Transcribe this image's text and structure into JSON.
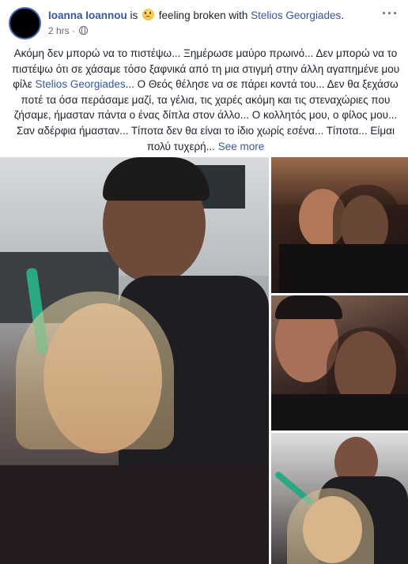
{
  "post": {
    "author": "Ioanna Ioannou",
    "is_text": "is",
    "feeling_icon": "crying-face-emoji",
    "feeling_text": "feeling broken with",
    "tagged_friend": "Stelios Georgiades",
    "period": ".",
    "timestamp": "2 hrs",
    "separator": "·",
    "privacy_icon": "globe-icon",
    "more_icon": "ellipsis-icon",
    "more_label": "···",
    "body_before_tag": "Ακόμη δεν μπορώ να το πιστέψω... Ξημέρωσε μαύρο πρωινό... Δεν μπορώ να το πιστέψω ότι σε χάσαμε τόσο ξαφνικά από τη μια στιγμή στην άλλη αγαπημένε μου φίλε ",
    "body_tag": "Stelios Georgiades",
    "body_after_tag": "... Ο Θεός θέλησε να σε πάρει κοντά του... Δεν θα ξεχάσω ποτέ τα όσα περάσαμε μαζί, τα γέλια, τις χαρές ακόμη και τις στεναχώριες που ζήσαμε, ήμασταν πάντα ο ένας δίπλα στον άλλο... Ο κολλητός μου, ο φίλος μου... Σαν αδέρφια ήμασταν... Τίποτα δεν θα είναι το ίδιο χωρίς εσένα... Τίποτα... Είμαι πολύ τυχερή... ",
    "see_more": "See more"
  },
  "photos": [
    {
      "name": "salon-selfie-main"
    },
    {
      "name": "restaurant-selfie"
    },
    {
      "name": "close-selfie"
    },
    {
      "name": "salon-selfie-small"
    }
  ],
  "colors": {
    "link": "#385898",
    "text": "#1d2129",
    "meta": "#606770"
  }
}
